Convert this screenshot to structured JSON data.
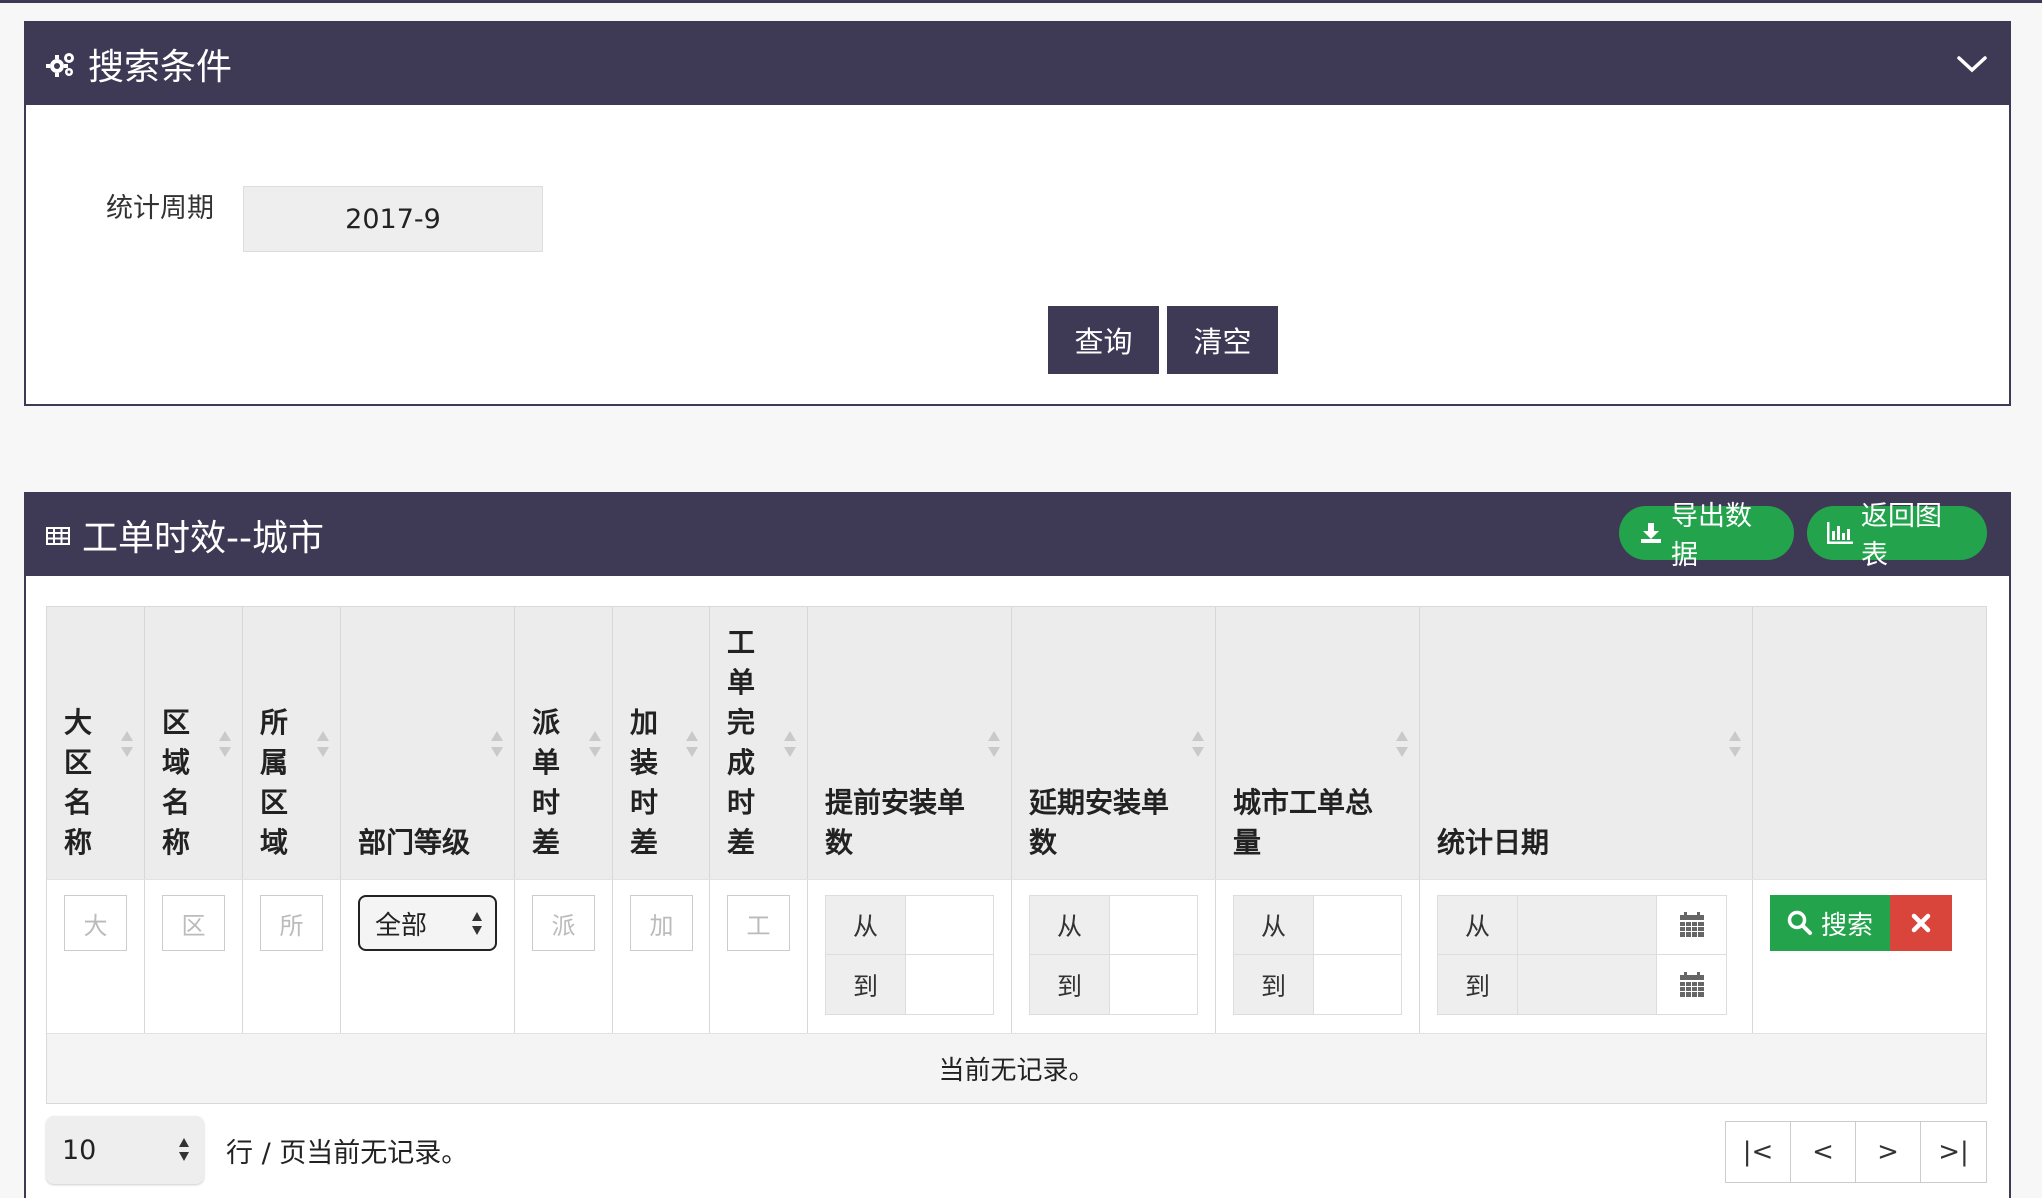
{
  "search_panel": {
    "title": "搜索条件",
    "period_label": "统计周期",
    "period_value": "2017-9",
    "query_button": "查询",
    "clear_button": "清空"
  },
  "result_panel": {
    "title": "工单时效--城市",
    "export_button": "导出数据",
    "back_to_chart_button": "返回图表"
  },
  "table": {
    "columns": [
      {
        "label": "大区名称",
        "filter_placeholder": "大"
      },
      {
        "label": "区域名称",
        "filter_placeholder": "区"
      },
      {
        "label": "所属区域",
        "filter_placeholder": "所"
      },
      {
        "label": "部门等级",
        "filter_value": "全部"
      },
      {
        "label": "派单时差",
        "filter_placeholder": "派"
      },
      {
        "label": "加装时差",
        "filter_placeholder": "加"
      },
      {
        "label": "工单完成时差",
        "filter_placeholder": "工"
      },
      {
        "label": "提前安装单数"
      },
      {
        "label": "延期安装单数"
      },
      {
        "label": "城市工单总量"
      },
      {
        "label": "统计日期"
      }
    ],
    "range_from": "从",
    "range_to": "到",
    "search_button": "搜索",
    "empty_message": "当前无记录。"
  },
  "pagination": {
    "page_size": "10",
    "info": "行 / 页当前无记录。",
    "first": "|<",
    "prev": "<",
    "next": ">",
    "last": ">|"
  },
  "colors": {
    "header_bg": "#3e3a56",
    "green": "#24a34d",
    "red": "#d9453b"
  },
  "icons": [
    "gears-icon",
    "chevron-down-icon",
    "table-icon",
    "download-icon",
    "bar-chart-icon",
    "sort-icon",
    "select-arrows-icon",
    "calendar-icon",
    "search-icon",
    "close-icon"
  ]
}
